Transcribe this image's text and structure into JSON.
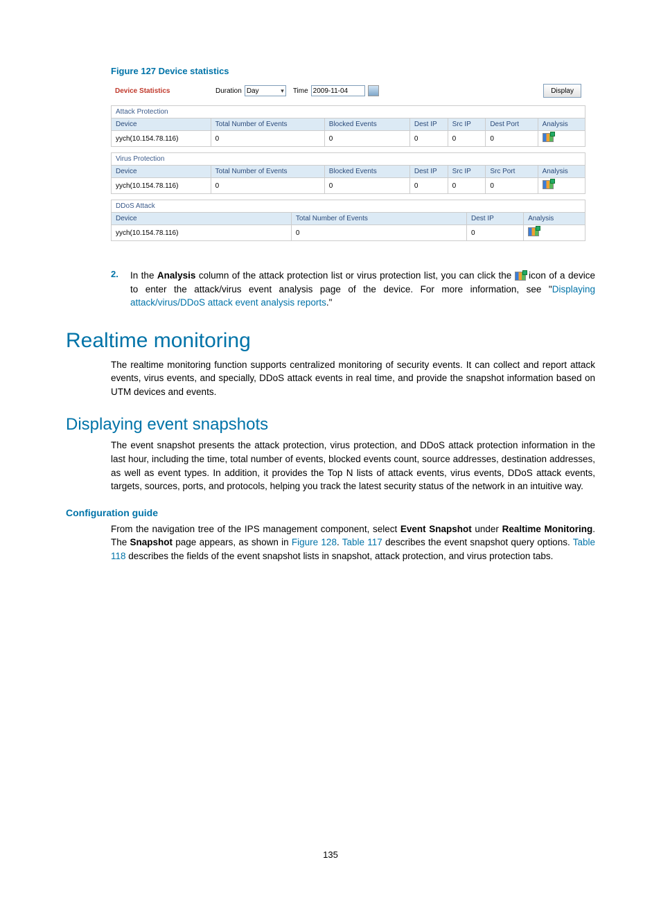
{
  "figure_caption": "Figure 127 Device statistics",
  "controls": {
    "title": "Device Statistics",
    "duration_label": "Duration",
    "duration_value": "Day",
    "time_label": "Time",
    "time_value": "2009-11-04",
    "display_btn": "Display"
  },
  "sections": [
    {
      "title": "Attack Protection",
      "headers": [
        "Device",
        "Total Number of Events",
        "Blocked Events",
        "Dest IP",
        "Src IP",
        "Dest Port",
        "Analysis"
      ],
      "rows": [
        [
          "yych(10.154.78.116)",
          "0",
          "0",
          "0",
          "0",
          "0",
          ""
        ]
      ]
    },
    {
      "title": "Virus Protection",
      "headers": [
        "Device",
        "Total Number of Events",
        "Blocked Events",
        "Dest IP",
        "Src IP",
        "Src Port",
        "Analysis"
      ],
      "rows": [
        [
          "yych(10.154.78.116)",
          "0",
          "0",
          "0",
          "0",
          "0",
          ""
        ]
      ]
    },
    {
      "title": "DDoS Attack",
      "headers": [
        "Device",
        "Total Number of Events",
        "Dest IP",
        "Analysis"
      ],
      "rows": [
        [
          "yych(10.154.78.116)",
          "0",
          "0",
          ""
        ]
      ]
    }
  ],
  "step2": {
    "num": "2.",
    "pre": "In the ",
    "b1": "Analysis",
    "mid": " column of the attack protection list or virus protection list, you can click the ",
    "post": " icon of a device to enter the attack/virus event analysis page of the device. For more information, see \"",
    "link": "Displaying attack/virus/DDoS attack event analysis reports",
    "end": ".\""
  },
  "h1": "Realtime monitoring",
  "p1": "The realtime monitoring function supports centralized monitoring of security events. It can collect and report attack events, virus events, and specially, DDoS attack events in real time, and provide the snapshot information based on UTM devices and events.",
  "h2": "Displaying event snapshots",
  "p2": "The event snapshot presents the attack protection, virus protection, and DDoS attack protection information in the last hour, including the time, total number of events, blocked events count, source addresses, destination addresses, as well as event types. In addition, it provides the Top N lists of attack events, virus events, DDoS attack events, targets, sources, ports, and protocols, helping you track the latest security status of the network in an intuitive way.",
  "cfg_head": "Configuration guide",
  "cfg": {
    "t1": "From the navigation tree of the IPS management component, select ",
    "b1": "Event Snapshot",
    "t2": " under ",
    "b2": "Realtime Monitoring",
    "t3": ". The ",
    "b3": "Snapshot",
    "t4": " page appears, as shown in ",
    "l1": "Figure 128",
    "t5": ". ",
    "l2": "Table 117",
    "t6": " describes the event snapshot query options. ",
    "l3": "Table 118",
    "t7": " describes the fields of the event snapshot lists in snapshot, attack protection, and virus protection tabs."
  },
  "page_number": "135"
}
